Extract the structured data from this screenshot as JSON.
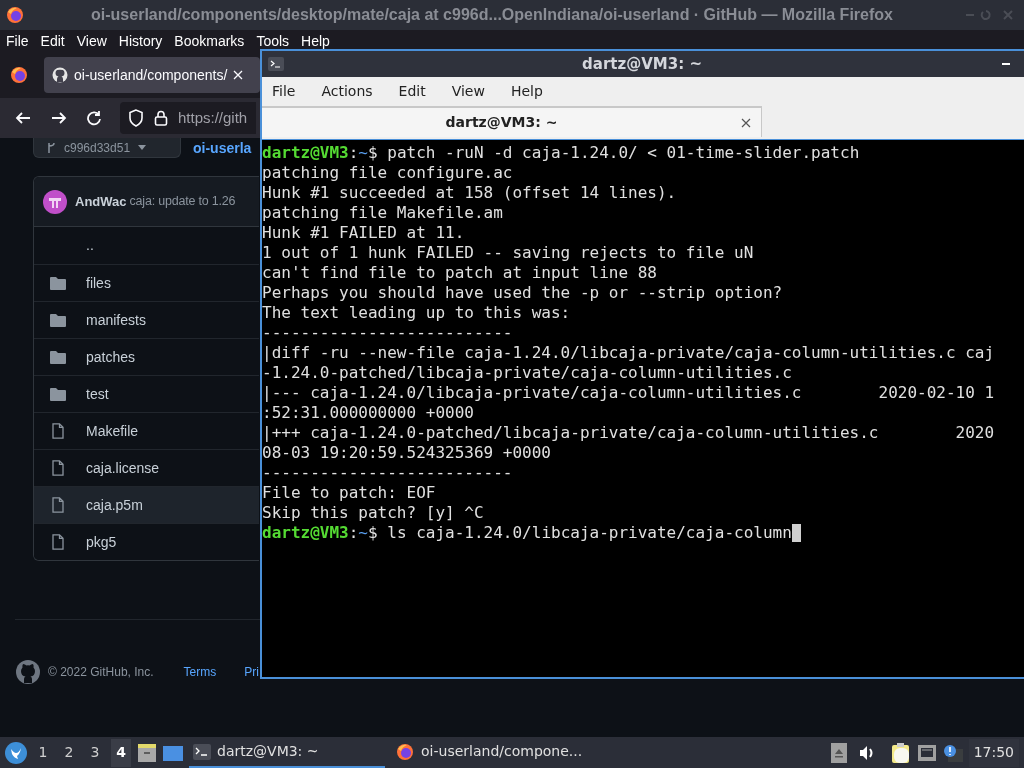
{
  "browser": {
    "title": "oi-userland/components/desktop/mate/caja at c996d...OpenIndiana/oi-userland · GitHub — Mozilla Firefox",
    "menu": [
      "File",
      "Edit",
      "View",
      "History",
      "Bookmarks",
      "Tools",
      "Help"
    ],
    "tabs": [
      {
        "label": "oi-userland/components/",
        "selected": true
      }
    ],
    "url": "https://gith",
    "page": {
      "branch": "c996d33d51",
      "breadcrumb": "oi-userla",
      "commit": {
        "author": "AndWac",
        "message": "caja: update to 1.26"
      },
      "files": [
        {
          "name": "..",
          "kind": "parent",
          "selected": false
        },
        {
          "name": "files",
          "kind": "folder",
          "selected": false
        },
        {
          "name": "manifests",
          "kind": "folder",
          "selected": false
        },
        {
          "name": "patches",
          "kind": "folder",
          "selected": false
        },
        {
          "name": "test",
          "kind": "folder",
          "selected": false
        },
        {
          "name": "Makefile",
          "kind": "file",
          "selected": false
        },
        {
          "name": "caja.license",
          "kind": "file",
          "selected": false
        },
        {
          "name": "caja.p5m",
          "kind": "file",
          "selected": true
        },
        {
          "name": "pkg5",
          "kind": "file",
          "selected": false
        }
      ],
      "footer": {
        "copyright": "© 2022 GitHub, Inc.",
        "links": [
          "Terms",
          "Pri"
        ]
      }
    }
  },
  "terminal": {
    "title": "dartz@VM3: ~",
    "menu": [
      "File",
      "Actions",
      "Edit",
      "View",
      "Help"
    ],
    "tabs": [
      {
        "label": "dartz@VM3: ~",
        "selected": true
      }
    ],
    "lines": [
      {
        "kind": "prompt",
        "user_host": "dartz@VM3",
        "separator": ":",
        "path": "~",
        "symbol": "$",
        "command": "patch -ruN -d caja-1.24.0/ < 01-time-slider.patch",
        "cursor": false
      },
      {
        "kind": "output",
        "text": "patching file configure.ac"
      },
      {
        "kind": "output",
        "text": "Hunk #1 succeeded at 158 (offset 14 lines)."
      },
      {
        "kind": "output",
        "text": "patching file Makefile.am"
      },
      {
        "kind": "output",
        "text": "Hunk #1 FAILED at 11."
      },
      {
        "kind": "output",
        "text": "1 out of 1 hunk FAILED -- saving rejects to file uN"
      },
      {
        "kind": "output",
        "text": "can't find file to patch at input line 88"
      },
      {
        "kind": "output",
        "text": "Perhaps you should have used the -p or --strip option?"
      },
      {
        "kind": "output",
        "text": "The text leading up to this was:"
      },
      {
        "kind": "output",
        "text": "--------------------------"
      },
      {
        "kind": "output",
        "text": "|diff -ru --new-file caja-1.24.0/libcaja-private/caja-column-utilities.c caj"
      },
      {
        "kind": "output",
        "text": "-1.24.0-patched/libcaja-private/caja-column-utilities.c"
      },
      {
        "kind": "output",
        "text": "|--- caja-1.24.0/libcaja-private/caja-column-utilities.c        2020-02-10 1"
      },
      {
        "kind": "output",
        "text": ":52:31.000000000 +0000"
      },
      {
        "kind": "output",
        "text": "|+++ caja-1.24.0-patched/libcaja-private/caja-column-utilities.c        2020"
      },
      {
        "kind": "output",
        "text": "08-03 19:20:59.524325369 +0000"
      },
      {
        "kind": "output",
        "text": "--------------------------"
      },
      {
        "kind": "output",
        "text": "File to patch: EOF"
      },
      {
        "kind": "output",
        "text": "Skip this patch? [y] ^C"
      },
      {
        "kind": "prompt",
        "user_host": "dartz@VM3",
        "separator": ":",
        "path": "~",
        "symbol": "$",
        "command": "ls caja-1.24.0/libcaja-private/caja-column",
        "cursor": true
      }
    ]
  },
  "taskbar": {
    "workspaces": [
      {
        "label": "1",
        "selected": false
      },
      {
        "label": "2",
        "selected": false
      },
      {
        "label": "3",
        "selected": false
      },
      {
        "label": "4",
        "selected": true
      }
    ],
    "tasks": [
      {
        "label": "dartz@VM3: ~",
        "kind": "terminal",
        "selected": true
      },
      {
        "label": "oi-userland/compone...",
        "kind": "browser",
        "selected": false
      }
    ],
    "clock": "17:50"
  }
}
